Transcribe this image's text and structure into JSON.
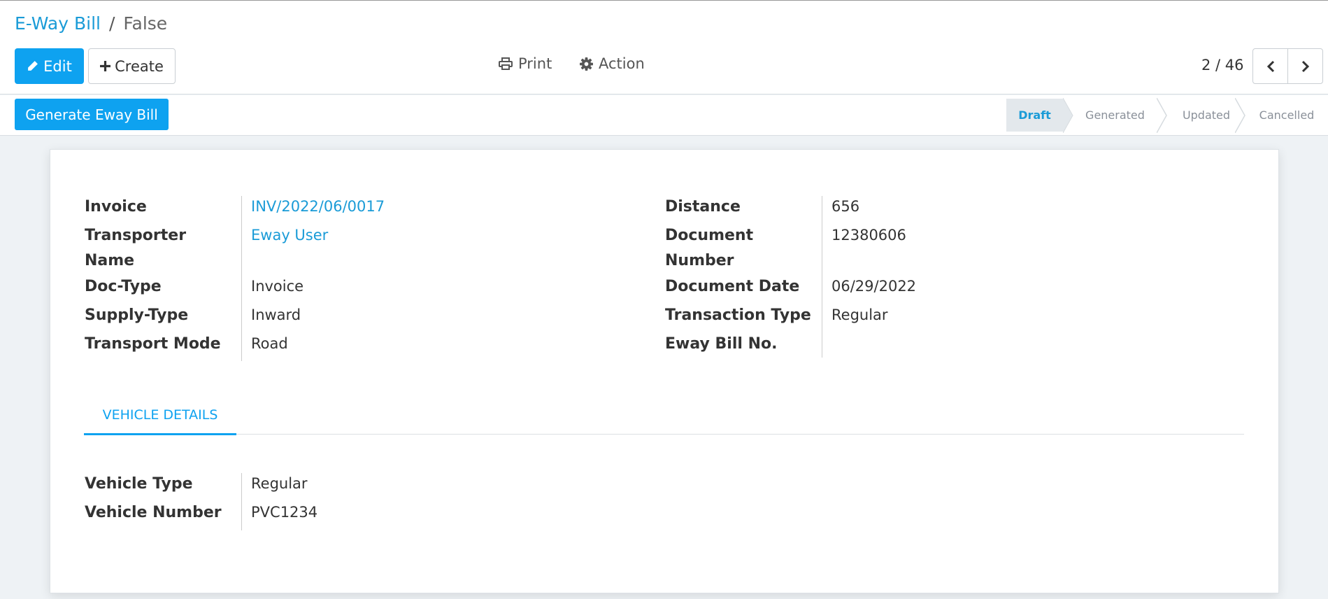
{
  "breadcrumb": {
    "parent": "E-Way Bill",
    "separator": "/",
    "current": "False"
  },
  "toolbar": {
    "edit_label": "Edit",
    "create_label": "Create",
    "print_label": "Print",
    "action_label": "Action"
  },
  "pager": {
    "value": "2 / 46"
  },
  "statusbar": {
    "generate_label": "Generate Eway Bill",
    "stages": [
      "Draft",
      "Generated",
      "Updated",
      "Cancelled"
    ],
    "active_stage": "Draft"
  },
  "form": {
    "left": [
      {
        "label": "Invoice",
        "value": "INV/2022/06/0017"
      },
      {
        "label": "Transporter Name",
        "value": "Eway User"
      },
      {
        "label": "Doc-Type",
        "value": "Invoice"
      },
      {
        "label": "Supply-Type",
        "value": "Inward"
      },
      {
        "label": "Transport Mode",
        "value": "Road"
      }
    ],
    "right": [
      {
        "label": "Distance",
        "value": "656"
      },
      {
        "label": "Document Number",
        "value": "12380606"
      },
      {
        "label": "Document Date",
        "value": "06/29/2022"
      },
      {
        "label": "Transaction Type",
        "value": "Regular"
      },
      {
        "label": "Eway Bill No.",
        "value": ""
      }
    ]
  },
  "tabs": [
    {
      "label": "VEHICLE DETAILS"
    }
  ],
  "vehicle": [
    {
      "label": "Vehicle Type",
      "value": "Regular"
    },
    {
      "label": "Vehicle Number",
      "value": "PVC1234"
    }
  ],
  "colors": {
    "primary": "#0ea2f0",
    "link": "#1a9bd7"
  }
}
